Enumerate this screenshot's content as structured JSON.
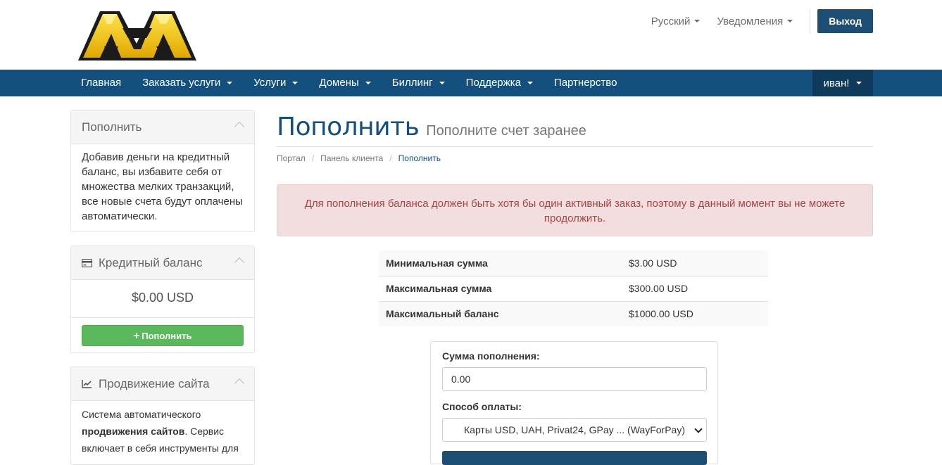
{
  "header": {
    "language": "Русский",
    "notifications": "Уведомления",
    "logout": "Выход"
  },
  "nav": {
    "items": [
      {
        "label": "Главная",
        "dropdown": false
      },
      {
        "label": "Заказать услуги",
        "dropdown": true
      },
      {
        "label": "Услуги",
        "dropdown": true
      },
      {
        "label": "Домены",
        "dropdown": true
      },
      {
        "label": "Биллинг",
        "dropdown": true
      },
      {
        "label": "Поддержка",
        "dropdown": true
      },
      {
        "label": "Партнерство",
        "dropdown": false
      }
    ],
    "user": "иван!"
  },
  "sidebar": {
    "topup_panel": {
      "title": "Пополнить",
      "text": "Добавив деньги на кредитный баланс, вы избавите себя от множества мелких транзакций, все новые счета будут оплачены автоматически."
    },
    "credit_panel": {
      "title": "Кредитный баланс",
      "balance": "$0.00 USD",
      "button": "Пополнить"
    },
    "promo_panel": {
      "title": "Продвижение сайта",
      "text_1": "Система автоматического",
      "text_bold": "продвижения сайтов",
      "text_2": ". Сервис включает в себя инструменты для"
    }
  },
  "page": {
    "title": "Пополнить",
    "subtitle": "Пополните счет заранее",
    "breadcrumb": [
      "Портал",
      "Панель клиента",
      "Пополнить"
    ],
    "alert": "Для пополнения баланса должен быть хотя бы один активный заказ, поэтому в данный момент вы не можете продолжить."
  },
  "limits": [
    {
      "label": "Минимальная сумма",
      "value": "$3.00 USD"
    },
    {
      "label": "Максимальная сумма",
      "value": "$300.00 USD"
    },
    {
      "label": "Максимальный баланс",
      "value": "$1000.00 USD"
    }
  ],
  "form": {
    "amount_label": "Сумма пополнения:",
    "amount_value": "0.00",
    "method_label": "Способ оплаты:",
    "method_selected": "Карты USD, UAH, Privat24, GPay ... (WayForPay)"
  },
  "colors": {
    "brand": "#13507e",
    "success": "#5cb85c",
    "alert_bg": "#f2dede",
    "alert_text": "#a94442"
  }
}
